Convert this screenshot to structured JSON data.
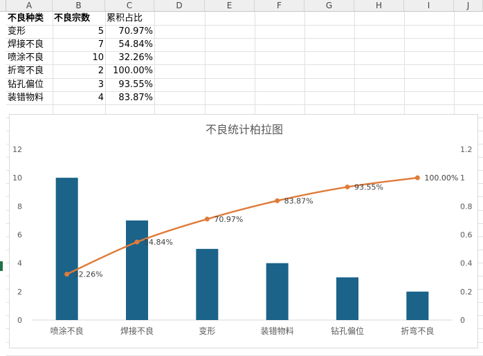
{
  "sheet": {
    "columns": [
      "A",
      "B",
      "C",
      "D",
      "E",
      "F",
      "G",
      "H",
      "I",
      "J"
    ],
    "header": [
      "不良种类",
      "不良宗数",
      "累积占比"
    ],
    "rows": [
      {
        "type": "变形",
        "count": "5",
        "cum": "70.97%"
      },
      {
        "type": "焊接不良",
        "count": "7",
        "cum": "54.84%"
      },
      {
        "type": "喷涂不良",
        "count": "10",
        "cum": "32.26%"
      },
      {
        "type": "折弯不良",
        "count": "2",
        "cum": "100.00%"
      },
      {
        "type": "钻孔偏位",
        "count": "3",
        "cum": "93.55%"
      },
      {
        "type": "装错物料",
        "count": "4",
        "cum": "83.87%"
      }
    ]
  },
  "chart_data": {
    "type": "bar",
    "title": "不良统计柏拉图",
    "categories": [
      "喷涂不良",
      "焊接不良",
      "变形",
      "装错物料",
      "钻孔偏位",
      "折弯不良"
    ],
    "series": [
      {
        "type": "bar",
        "values": [
          10,
          7,
          5,
          4,
          3,
          2
        ],
        "axis": "left",
        "color": "#1b6389"
      },
      {
        "type": "line",
        "values": [
          0.3226,
          0.5484,
          0.7097,
          0.8387,
          0.9355,
          1.0
        ],
        "axis": "right",
        "color": "#e07b39",
        "labels": [
          "32.26%",
          "54.84%",
          "70.97%",
          "83.87%",
          "93.55%",
          "100.00%"
        ]
      }
    ],
    "ylim": [
      0,
      12
    ],
    "yticks": [
      "0",
      "2",
      "4",
      "6",
      "8",
      "10",
      "12"
    ],
    "y2lim": [
      0,
      1.2
    ],
    "y2ticks": [
      "0",
      "0.2",
      "0.4",
      "0.6",
      "0.8",
      "1",
      "1.2"
    ],
    "grid": false,
    "legend": "none"
  }
}
